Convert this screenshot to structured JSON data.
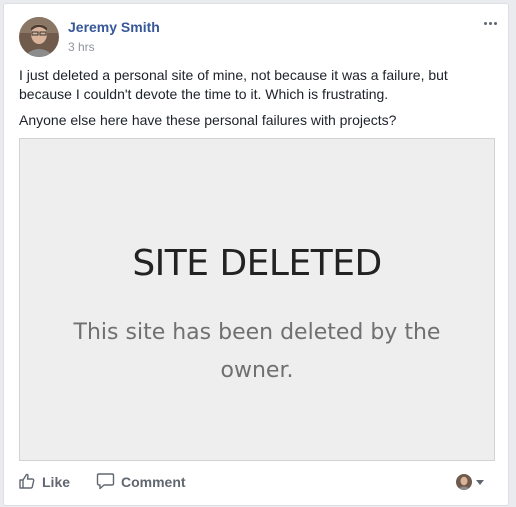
{
  "post": {
    "author": "Jeremy Smith",
    "time": "3 hrs",
    "paragraphs": [
      "I just deleted a personal site of mine, not because it was a failure, but because I couldn't devote the time to it. Which is frustrating.",
      "Anyone else here have these personal failures with projects?"
    ],
    "preview": {
      "headline": "SITE DELETED",
      "message": "This site has been deleted by the owner."
    }
  },
  "actions": {
    "like_label": "Like",
    "comment_label": "Comment"
  },
  "icons": {
    "avatar": "user-avatar",
    "more": "more-horizontal-icon",
    "like": "thumbs-up-icon",
    "comment": "comment-bubble-icon",
    "audience_caret": "chevron-down-icon"
  },
  "colors": {
    "author": "#365899",
    "background": "#e9ebee",
    "action_text": "#606770"
  }
}
